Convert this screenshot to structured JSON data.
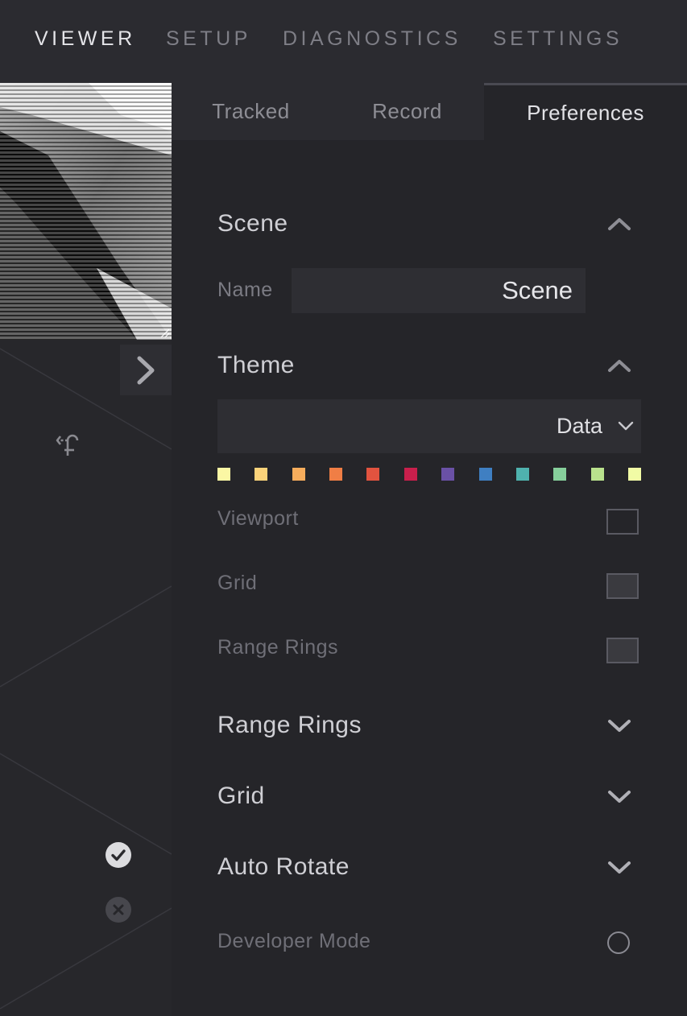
{
  "nav": {
    "tabs": [
      {
        "label": "VIEWER",
        "active": true
      },
      {
        "label": "SETUP",
        "active": false
      },
      {
        "label": "DIAGNOSTICS",
        "active": false
      },
      {
        "label": "SETTINGS",
        "active": false
      }
    ]
  },
  "viewport": {
    "icons": [
      "chevron-right-icon",
      "rotate-icon",
      "check-circle-icon",
      "close-circle-icon"
    ]
  },
  "panel": {
    "subtabs": [
      {
        "label": "Tracked",
        "active": false
      },
      {
        "label": "Record",
        "active": false
      },
      {
        "label": "Preferences",
        "active": true
      }
    ],
    "scene": {
      "title": "Scene",
      "expanded": true,
      "name_label": "Name",
      "name_value": "Scene"
    },
    "theme": {
      "title": "Theme",
      "expanded": true,
      "selected": "Data",
      "palette": [
        "#fbf7a4",
        "#fbd37a",
        "#f7ad5c",
        "#f07e45",
        "#e2533f",
        "#c91f4c",
        "#6a51a6",
        "#3f7fc2",
        "#4fb2ae",
        "#86cf9b",
        "#b9e28d",
        "#f1fba5"
      ],
      "options": [
        {
          "label": "Viewport",
          "checked": false
        },
        {
          "label": "Grid",
          "checked": false
        },
        {
          "label": "Range Rings",
          "checked": false
        }
      ]
    },
    "collapsed_sections": [
      {
        "title": "Range Rings"
      },
      {
        "title": "Grid"
      },
      {
        "title": "Auto Rotate"
      }
    ],
    "developer_mode": {
      "label": "Developer Mode",
      "enabled": false
    }
  }
}
